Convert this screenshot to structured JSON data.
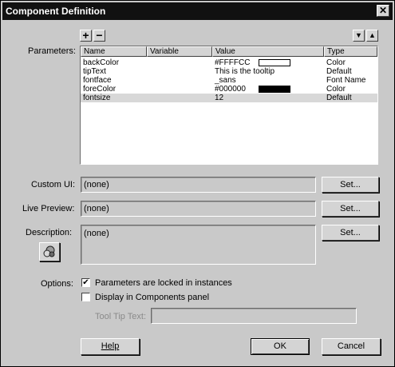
{
  "window": {
    "title": "Component Definition",
    "close_glyph": "✕"
  },
  "parameters": {
    "label": "Parameters:",
    "add_glyph": "+",
    "remove_glyph": "−",
    "move_down_glyph": "▼",
    "move_up_glyph": "▲",
    "columns": [
      "Name",
      "Variable",
      "Value",
      "Type"
    ],
    "rows": [
      {
        "name": "backColor",
        "variable": "",
        "value": "#FFFFCC",
        "type": "Color",
        "swatch": "#FFFFFF"
      },
      {
        "name": "tipText",
        "variable": "",
        "value": "This is the tooltip",
        "type": "Default"
      },
      {
        "name": "fontface",
        "variable": "",
        "value": "_sans",
        "type": "Font Name"
      },
      {
        "name": "foreColor",
        "variable": "",
        "value": "#000000",
        "type": "Color",
        "swatch": "#000000"
      },
      {
        "name": "fontsize",
        "variable": "",
        "value": "12",
        "type": "Default"
      }
    ]
  },
  "custom_ui": {
    "label": "Custom UI:",
    "value": "(none)",
    "button": "Set..."
  },
  "live_preview": {
    "label": "Live Preview:",
    "value": "(none)",
    "button": "Set..."
  },
  "description": {
    "label": "Description:",
    "value": "(none)",
    "button": "Set..."
  },
  "options": {
    "label": "Options:",
    "locked_label": "Parameters are locked in instances",
    "locked_checked": true,
    "display_label": "Display in Components panel",
    "display_checked": false,
    "tooltip_label": "Tool Tip Text:",
    "tooltip_value": ""
  },
  "buttons": {
    "help": "Help",
    "ok": "OK",
    "cancel": "Cancel"
  }
}
